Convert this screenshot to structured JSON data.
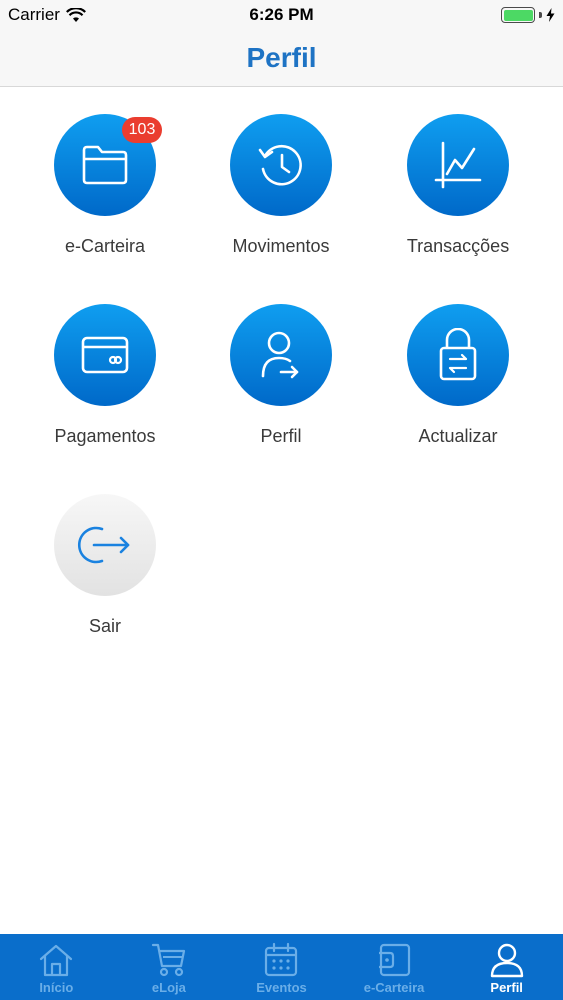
{
  "status_bar": {
    "carrier": "Carrier",
    "time": "6:26 PM"
  },
  "nav": {
    "title": "Perfil"
  },
  "tiles": [
    {
      "label": "e-Carteira",
      "icon": "folder-icon",
      "badge": "103"
    },
    {
      "label": "Movimentos",
      "icon": "history-icon"
    },
    {
      "label": "Transacções",
      "icon": "chart-line-icon"
    },
    {
      "label": "Pagamentos",
      "icon": "card-icon"
    },
    {
      "label": "Perfil",
      "icon": "user-icon"
    },
    {
      "label": "Actualizar",
      "icon": "lock-swap-icon"
    },
    {
      "label": "Sair",
      "icon": "logout-icon"
    }
  ],
  "tab_bar": {
    "items": [
      {
        "label": "Início",
        "icon": "home-icon",
        "active": false
      },
      {
        "label": "eLoja",
        "icon": "cart-icon",
        "active": false
      },
      {
        "label": "Eventos",
        "icon": "calendar-icon",
        "active": false
      },
      {
        "label": "e-Carteira",
        "icon": "wallet-icon",
        "active": false
      },
      {
        "label": "Perfil",
        "icon": "user-icon",
        "active": true
      }
    ]
  },
  "colors": {
    "brand_blue": "#1e73c4",
    "tab_bar": "#0a6ecb",
    "badge": "#ea3d2f",
    "battery": "#4cd964"
  }
}
